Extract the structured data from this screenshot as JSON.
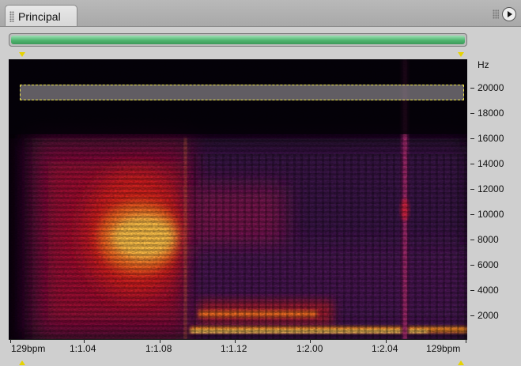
{
  "tab": {
    "label": "Principal"
  },
  "colors": {
    "scroll_thumb": "#4fb56f",
    "selection_border": "#f0e64a",
    "marker": "#e6d300",
    "background": "#050108"
  },
  "icons": {
    "panel_menu": "triangle-play-icon",
    "grip": "grip-dots-icon"
  },
  "spectrogram": {
    "y_unit": "Hz",
    "y_ticks": [
      "20000",
      "18000",
      "16000",
      "14000",
      "12000",
      "10000",
      "8000",
      "6000",
      "4000",
      "2000"
    ],
    "x_ticks": [
      "129bpm",
      "1:1.04",
      "1:1.08",
      "1:1.12",
      "1:2.00",
      "1:2.04",
      "129bpm"
    ],
    "selection_band_hz": [
      19000,
      20500
    ]
  }
}
